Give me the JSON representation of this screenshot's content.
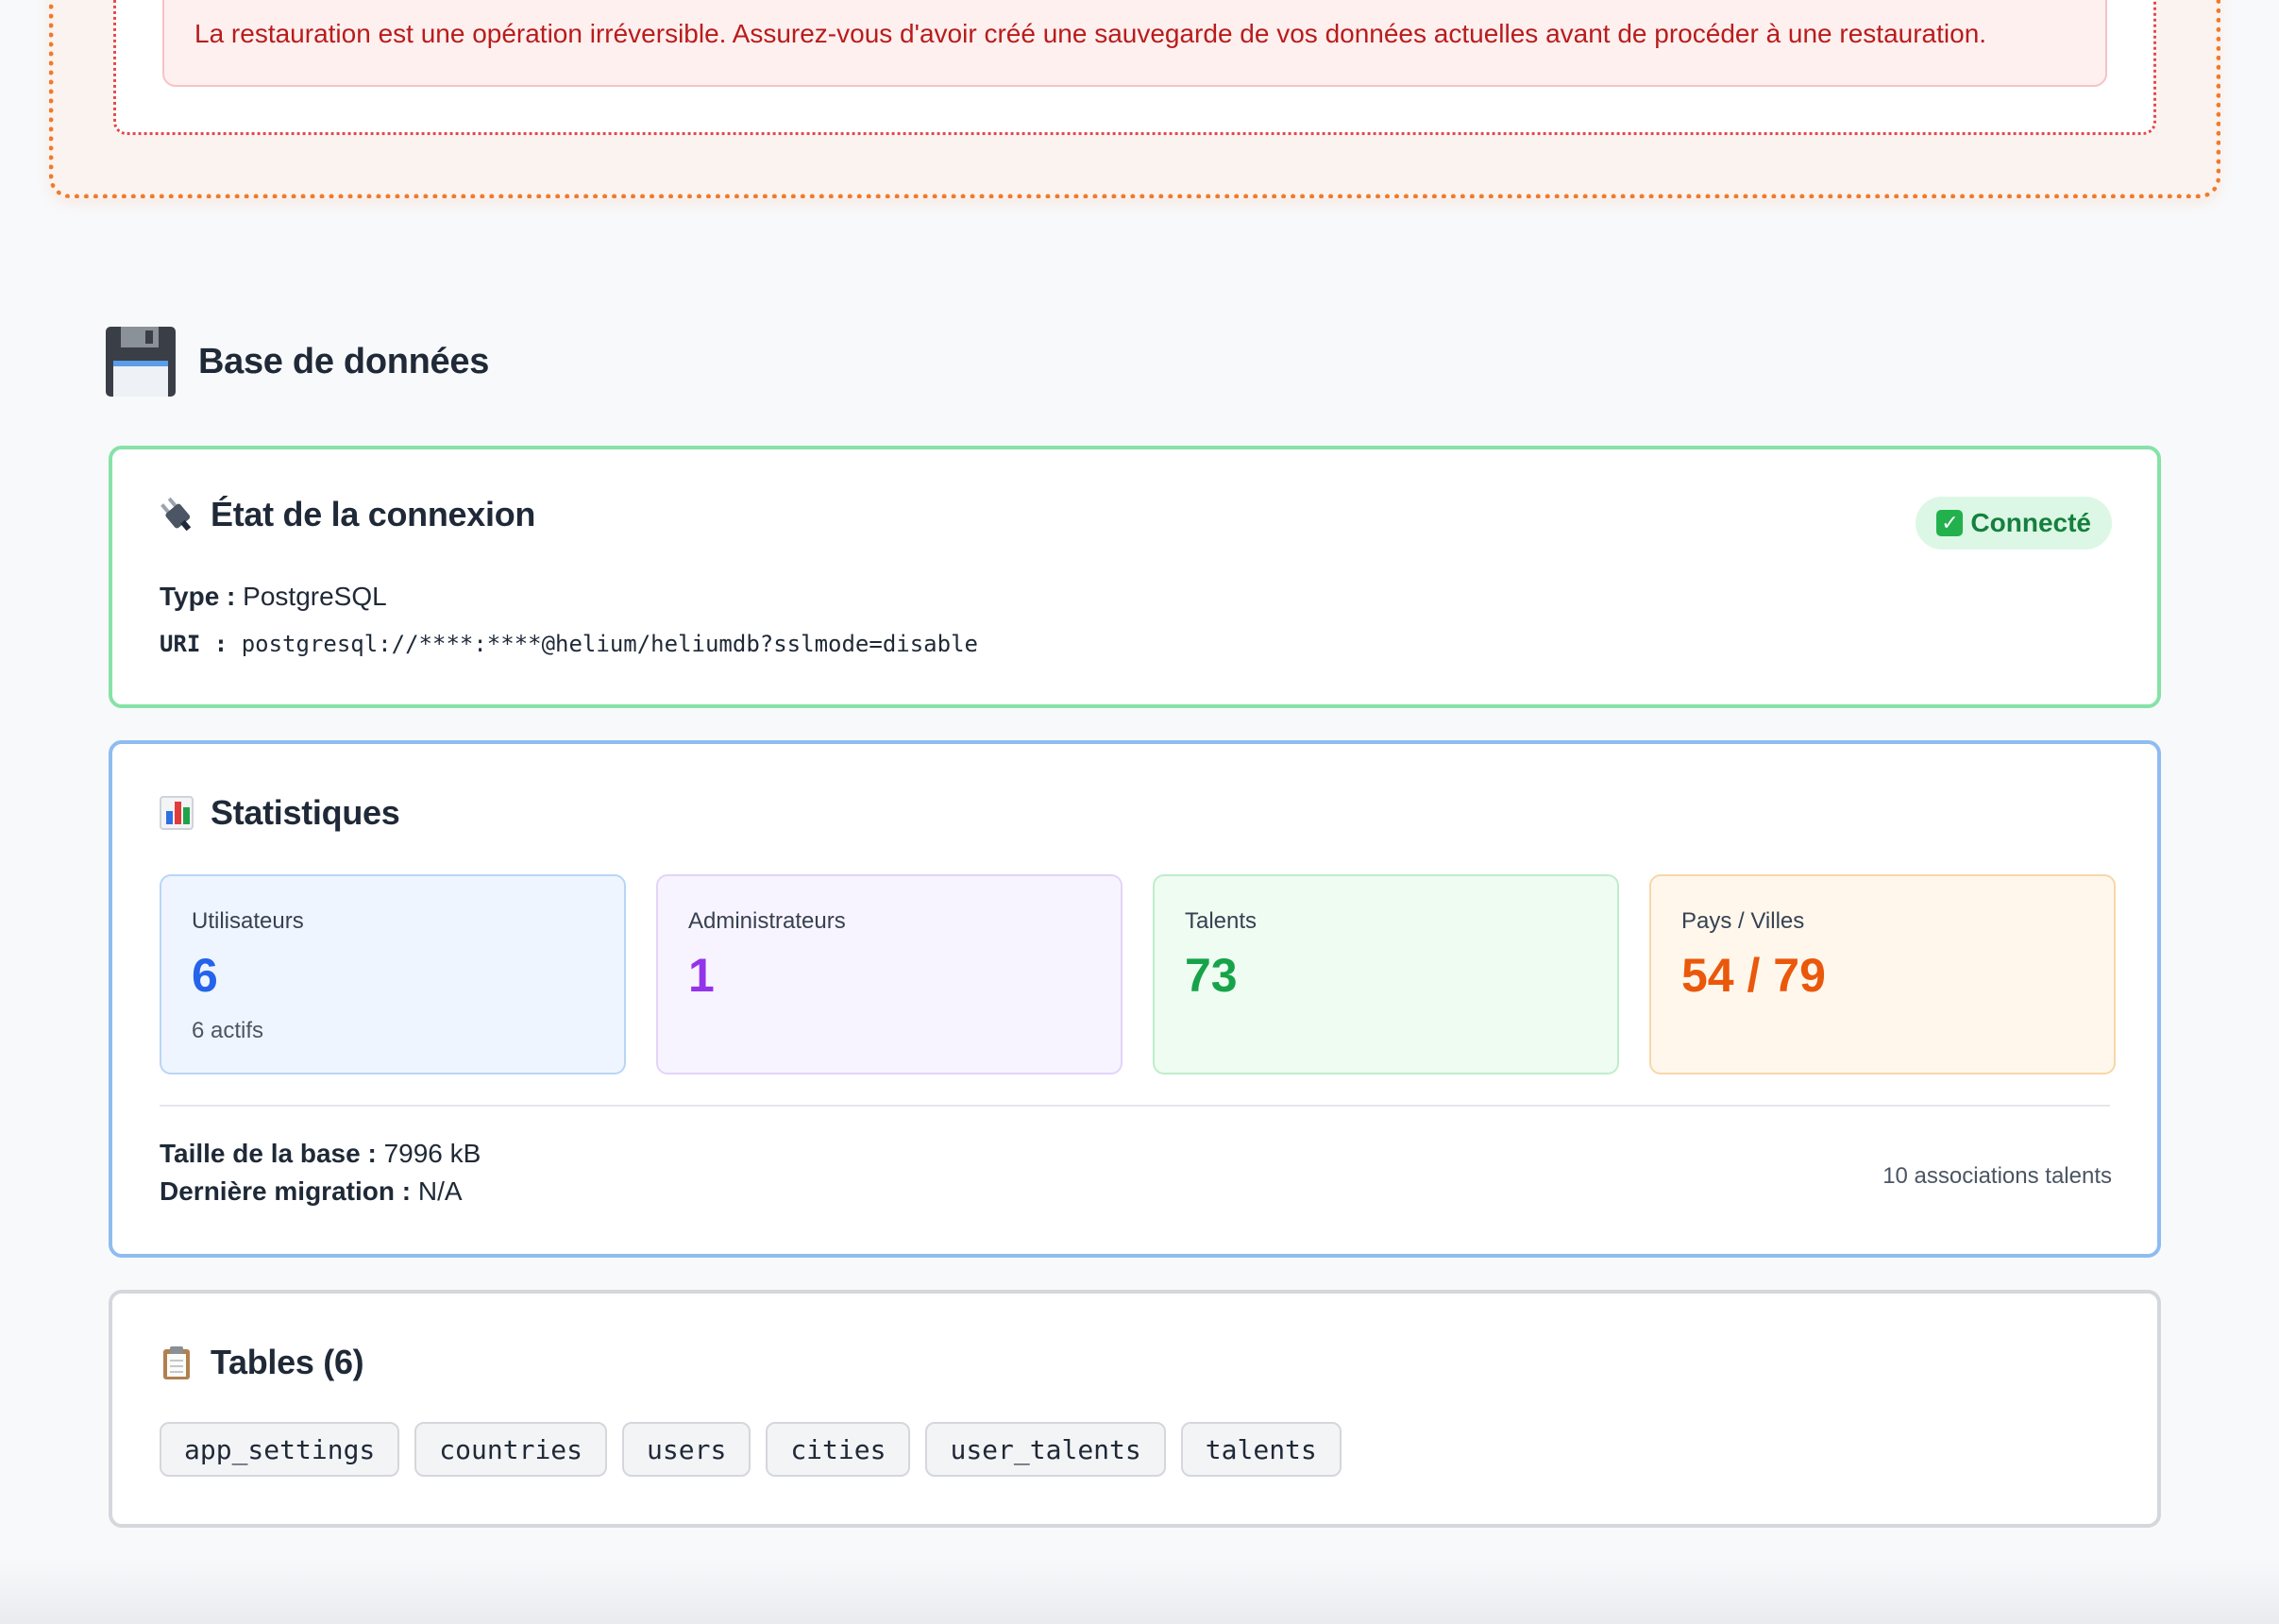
{
  "restore": {
    "warning_text": "La restauration est une opération irréversible. Assurez-vous d'avoir créé une sauvegarde de vos données actuelles avant de procéder à une restauration."
  },
  "section": {
    "icon": "floppy-disk-icon",
    "title": "Base de données"
  },
  "connection": {
    "icon": "plug-icon",
    "title": "État de la connexion",
    "status_badge": "Connecté",
    "status_color": "#15803d",
    "type_label": "Type :",
    "type_value": "PostgreSQL",
    "uri_label": "URI :",
    "uri_value": "postgresql://****:****@helium/heliumdb?sslmode=disable"
  },
  "stats": {
    "icon": "bar-chart-icon",
    "title": "Statistiques",
    "boxes": [
      {
        "label": "Utilisateurs",
        "value": "6",
        "sub": "6 actifs",
        "color": "#2563eb"
      },
      {
        "label": "Administrateurs",
        "value": "1",
        "color": "#9333ea"
      },
      {
        "label": "Talents",
        "value": "73",
        "color": "#16a34a"
      },
      {
        "label": "Pays / Villes",
        "value": "54 / 79",
        "color": "#ea580c"
      }
    ],
    "size_label": "Taille de la base :",
    "size_value": "7996 kB",
    "migration_label": "Dernière migration :",
    "migration_value": "N/A",
    "associations": "10 associations talents"
  },
  "tables": {
    "icon": "clipboard-icon",
    "title": "Tables (6)",
    "items": [
      "app_settings",
      "countries",
      "users",
      "cities",
      "user_talents",
      "talents"
    ]
  }
}
